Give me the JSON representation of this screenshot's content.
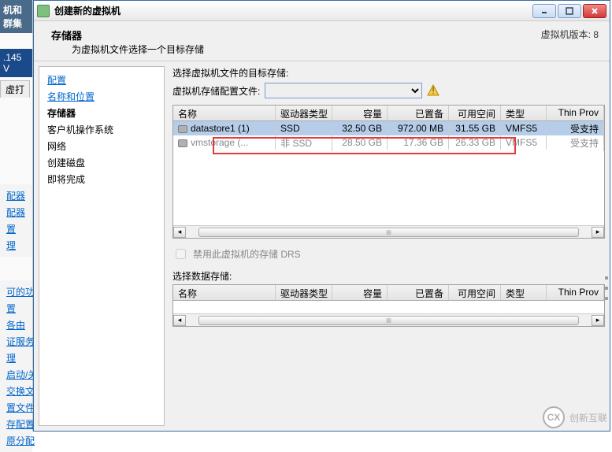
{
  "bg": {
    "head_fragment": "机和群集",
    "ip_fragment": ".145 V",
    "tab_fragment": "虚打",
    "items_upper": [
      "配器",
      "配器",
      "置",
      "理"
    ],
    "items_lower": [
      "可的功",
      "置",
      "各由",
      "证服务",
      "理",
      "启动/关",
      "交换文1",
      "置文件",
      "存配置",
      "原分配"
    ]
  },
  "dialog": {
    "title": "创建新的虚拟机",
    "header_title": "存储器",
    "header_sub": "为虚拟机文件选择一个目标存储",
    "version_label": "虚拟机版本: 8"
  },
  "steps": [
    {
      "label": "配置",
      "kind": "link"
    },
    {
      "label": "名称和位置",
      "kind": "link"
    },
    {
      "label": "存储器",
      "kind": "current"
    },
    {
      "label": "客户机操作系统",
      "kind": "plain"
    },
    {
      "label": "网络",
      "kind": "plain"
    },
    {
      "label": "创建磁盘",
      "kind": "plain"
    },
    {
      "label": "即将完成",
      "kind": "plain"
    }
  ],
  "main": {
    "select_target_label": "选择虚拟机文件的目标存储:",
    "profile_label": "虚拟机存储配置文件:",
    "profile_value": "",
    "grid1": {
      "headers": [
        "名称",
        "驱动器类型",
        "容量",
        "已置备",
        "可用空间",
        "类型",
        "Thin Prov"
      ],
      "rows": [
        {
          "name": "datastore1 (1)",
          "drive": "SSD",
          "capacity": "32.50 GB",
          "provisioned": "972.00 MB",
          "free": "31.55 GB",
          "type": "VMFS5",
          "thin": "受支持",
          "selected": true
        },
        {
          "name": "vmstorage (...",
          "drive": "非 SSD",
          "capacity": "28.50 GB",
          "provisioned": "17.36 GB",
          "free": "26.33 GB",
          "type": "VMFS5",
          "thin": "受支持",
          "selected": false
        }
      ]
    },
    "disable_drs_label": "禁用此虚拟机的存储 DRS",
    "select_datastore_label": "选择数据存储:",
    "grid2": {
      "headers": [
        "名称",
        "驱动器类型",
        "容量",
        "已置备",
        "可用空间",
        "类型",
        "Thin Prov"
      ]
    }
  },
  "watermark": {
    "brand": "创新互联",
    "logo": "CX"
  }
}
